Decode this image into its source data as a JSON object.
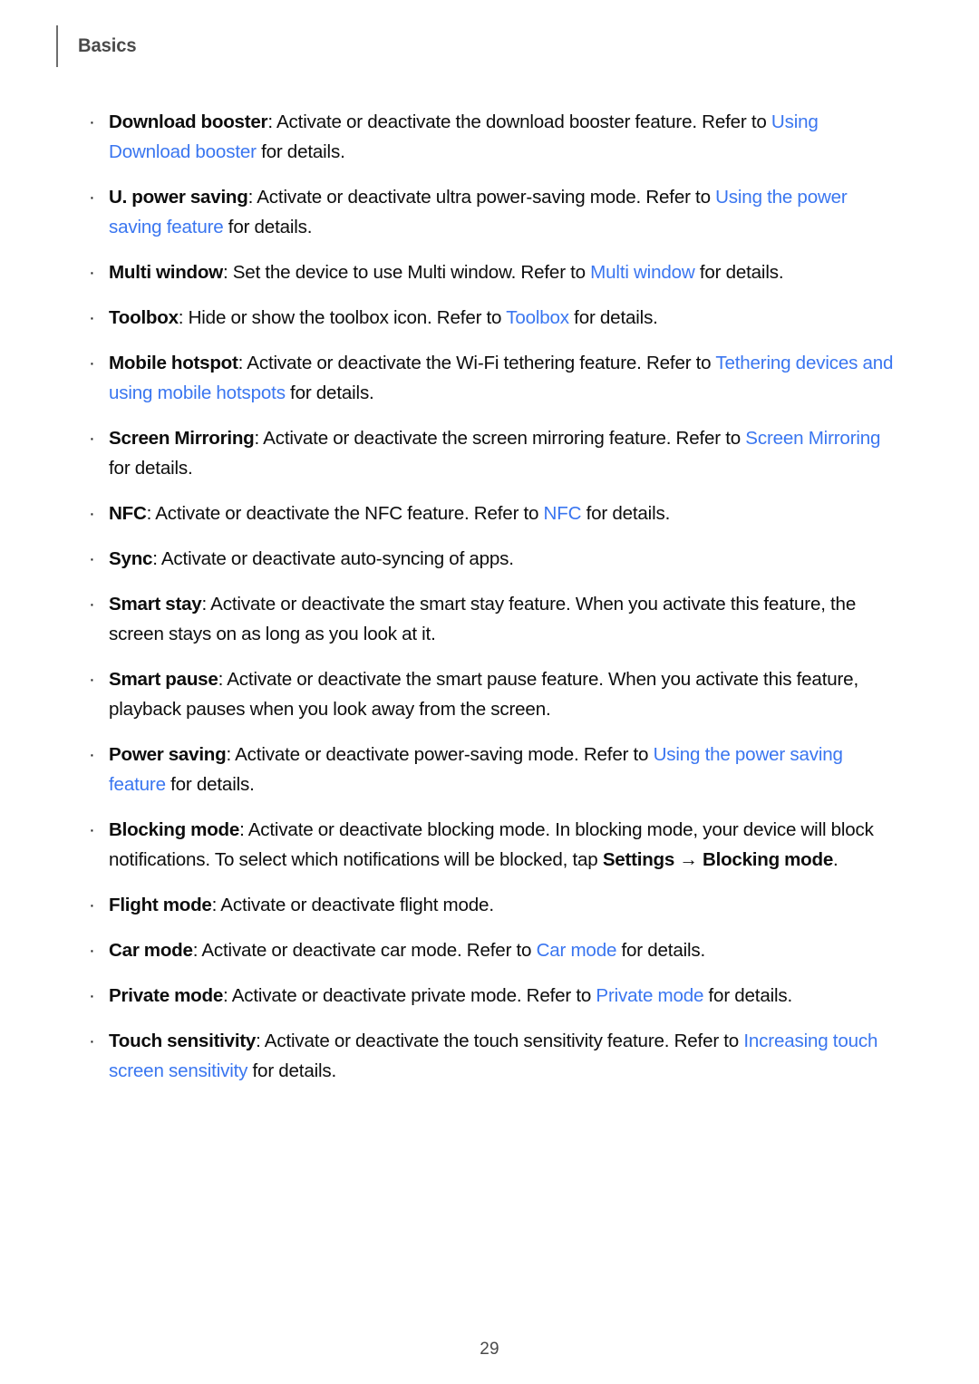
{
  "header": {
    "title": "Basics"
  },
  "footer": {
    "page_number": "29"
  },
  "colors": {
    "link": "#3a76f0",
    "body_text": "#0d0d0d",
    "header_text": "#4a4a4a",
    "rule": "#6e6e6e",
    "background": "#ffffff"
  },
  "bullet_marker": "·",
  "content": {
    "bullets": [
      {
        "id": "download-booster",
        "runs": [
          {
            "style": "bold",
            "text": "Download booster"
          },
          {
            "style": "normal",
            "text": ": Activate or deactivate the download booster feature. Refer to "
          },
          {
            "style": "link",
            "text": "Using Download booster"
          },
          {
            "style": "normal",
            "text": " for details."
          }
        ]
      },
      {
        "id": "u-power-saving",
        "runs": [
          {
            "style": "bold",
            "text": "U. power saving"
          },
          {
            "style": "normal",
            "text": ": Activate or deactivate ultra power-saving mode. Refer to "
          },
          {
            "style": "link",
            "text": "Using the power saving feature"
          },
          {
            "style": "normal",
            "text": " for details."
          }
        ]
      },
      {
        "id": "multi-window",
        "runs": [
          {
            "style": "bold",
            "text": "Multi window"
          },
          {
            "style": "normal",
            "text": ": Set the device to use Multi window. Refer to "
          },
          {
            "style": "link",
            "text": "Multi window"
          },
          {
            "style": "normal",
            "text": " for details."
          }
        ]
      },
      {
        "id": "toolbox",
        "runs": [
          {
            "style": "bold",
            "text": "Toolbox"
          },
          {
            "style": "normal",
            "text": ": Hide or show the toolbox icon. Refer to "
          },
          {
            "style": "link",
            "text": "Toolbox"
          },
          {
            "style": "normal",
            "text": " for details."
          }
        ]
      },
      {
        "id": "mobile-hotspot",
        "runs": [
          {
            "style": "bold",
            "text": "Mobile hotspot"
          },
          {
            "style": "normal",
            "text": ": Activate or deactivate the Wi-Fi tethering feature. Refer to "
          },
          {
            "style": "link",
            "text": "Tethering devices and using mobile hotspots"
          },
          {
            "style": "normal",
            "text": " for details."
          }
        ]
      },
      {
        "id": "screen-mirroring",
        "runs": [
          {
            "style": "bold",
            "text": "Screen Mirroring"
          },
          {
            "style": "normal",
            "text": ": Activate or deactivate the screen mirroring feature. Refer to "
          },
          {
            "style": "link",
            "text": "Screen Mirroring"
          },
          {
            "style": "normal",
            "text": " for details."
          }
        ]
      },
      {
        "id": "nfc",
        "runs": [
          {
            "style": "bold",
            "text": "NFC"
          },
          {
            "style": "normal",
            "text": ": Activate or deactivate the NFC feature. Refer to "
          },
          {
            "style": "link",
            "text": "NFC"
          },
          {
            "style": "normal",
            "text": " for details."
          }
        ]
      },
      {
        "id": "sync",
        "runs": [
          {
            "style": "bold",
            "text": "Sync"
          },
          {
            "style": "normal",
            "text": ": Activate or deactivate auto-syncing of apps."
          }
        ]
      },
      {
        "id": "smart-stay",
        "runs": [
          {
            "style": "bold",
            "text": "Smart stay"
          },
          {
            "style": "normal",
            "text": ": Activate or deactivate the smart stay feature. When you activate this feature, the screen stays on as long as you look at it."
          }
        ]
      },
      {
        "id": "smart-pause",
        "runs": [
          {
            "style": "bold",
            "text": "Smart pause"
          },
          {
            "style": "normal",
            "text": ": Activate or deactivate the smart pause feature. When you activate this feature, playback pauses when you look away from the screen."
          }
        ]
      },
      {
        "id": "power-saving",
        "runs": [
          {
            "style": "bold",
            "text": "Power saving"
          },
          {
            "style": "normal",
            "text": ": Activate or deactivate power-saving mode. Refer to "
          },
          {
            "style": "link",
            "text": "Using the power saving feature"
          },
          {
            "style": "normal",
            "text": " for details."
          }
        ]
      },
      {
        "id": "blocking-mode",
        "runs": [
          {
            "style": "bold",
            "text": "Blocking mode"
          },
          {
            "style": "normal",
            "text": ": Activate or deactivate blocking mode. In blocking mode, your device will block notifications. To select which notifications will be blocked, tap "
          },
          {
            "style": "bold",
            "text": "Settings"
          },
          {
            "style": "arrow",
            "text": " → "
          },
          {
            "style": "bold",
            "text": "Blocking mode"
          },
          {
            "style": "normal",
            "text": "."
          }
        ]
      },
      {
        "id": "flight-mode",
        "runs": [
          {
            "style": "bold",
            "text": "Flight mode"
          },
          {
            "style": "normal",
            "text": ": Activate or deactivate flight mode."
          }
        ]
      },
      {
        "id": "car-mode",
        "runs": [
          {
            "style": "bold",
            "text": "Car mode"
          },
          {
            "style": "normal",
            "text": ": Activate or deactivate car mode. Refer to "
          },
          {
            "style": "link",
            "text": "Car mode"
          },
          {
            "style": "normal",
            "text": " for details."
          }
        ]
      },
      {
        "id": "private-mode",
        "runs": [
          {
            "style": "bold",
            "text": "Private mode"
          },
          {
            "style": "normal",
            "text": ": Activate or deactivate private mode. Refer to "
          },
          {
            "style": "link",
            "text": "Private mode"
          },
          {
            "style": "normal",
            "text": " for details."
          }
        ]
      },
      {
        "id": "touch-sensitivity",
        "runs": [
          {
            "style": "bold",
            "text": "Touch sensitivity"
          },
          {
            "style": "normal",
            "text": ": Activate or deactivate the touch sensitivity feature. Refer to "
          },
          {
            "style": "link",
            "text": "Increasing touch screen sensitivity"
          },
          {
            "style": "normal",
            "text": " for details."
          }
        ]
      }
    ]
  }
}
